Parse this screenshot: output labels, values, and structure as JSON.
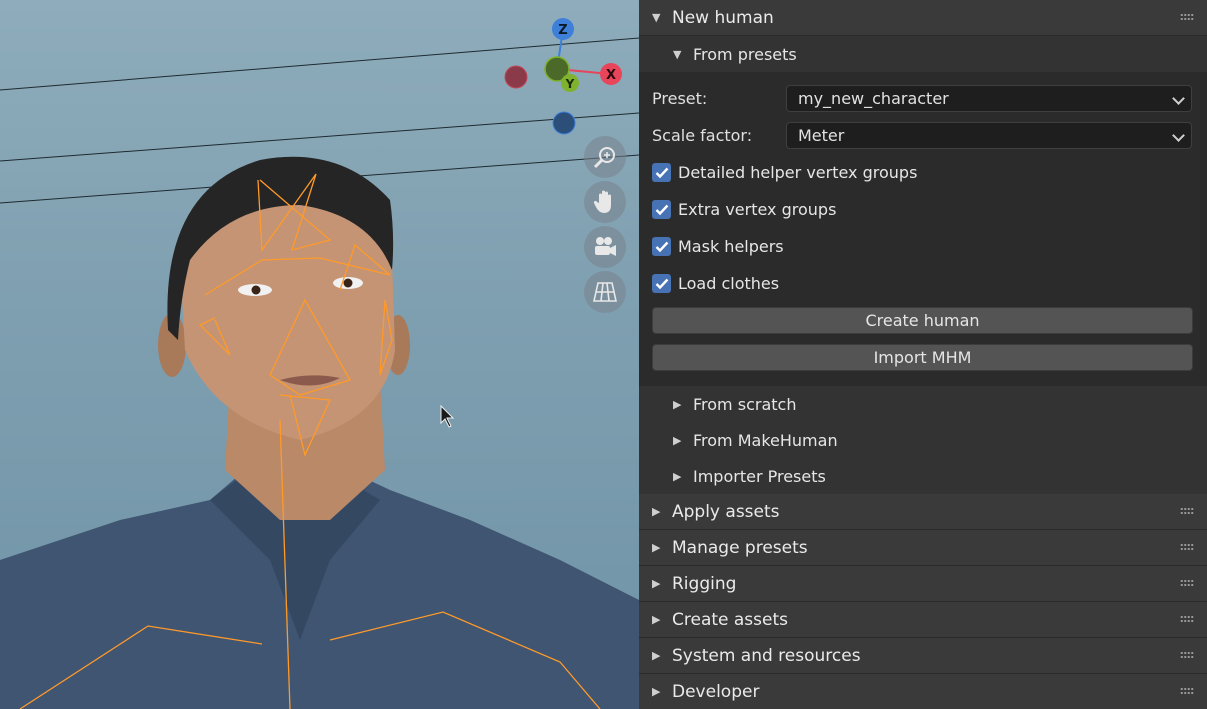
{
  "viewport": {
    "gizmo": {
      "z_label": "Z",
      "x_label": "X",
      "y_label": "Y"
    },
    "nav_icons": [
      "zoom-icon",
      "pan-hand-icon",
      "camera-icon",
      "grid-icon"
    ]
  },
  "panel": {
    "new_human": {
      "label": "New human",
      "from_presets": {
        "label": "From presets",
        "preset_label": "Preset:",
        "preset_value": "my_new_character",
        "scale_label": "Scale factor:",
        "scale_value": "Meter",
        "checkboxes": [
          {
            "label": "Detailed helper vertex groups",
            "checked": true
          },
          {
            "label": "Extra vertex groups",
            "checked": true
          },
          {
            "label": "Mask helpers",
            "checked": true
          },
          {
            "label": "Load clothes",
            "checked": true
          }
        ],
        "create_button": "Create human",
        "import_button": "Import MHM"
      },
      "subpanels": [
        "From scratch",
        "From MakeHuman",
        "Importer Presets"
      ]
    },
    "sections": [
      "Apply assets",
      "Manage presets",
      "Rigging",
      "Create assets",
      "System and resources",
      "Developer"
    ]
  },
  "colors": {
    "accent": "#4772b3",
    "axis_x": "#e8445a",
    "axis_y": "#7fb22d",
    "axis_z": "#3d7fd9"
  }
}
